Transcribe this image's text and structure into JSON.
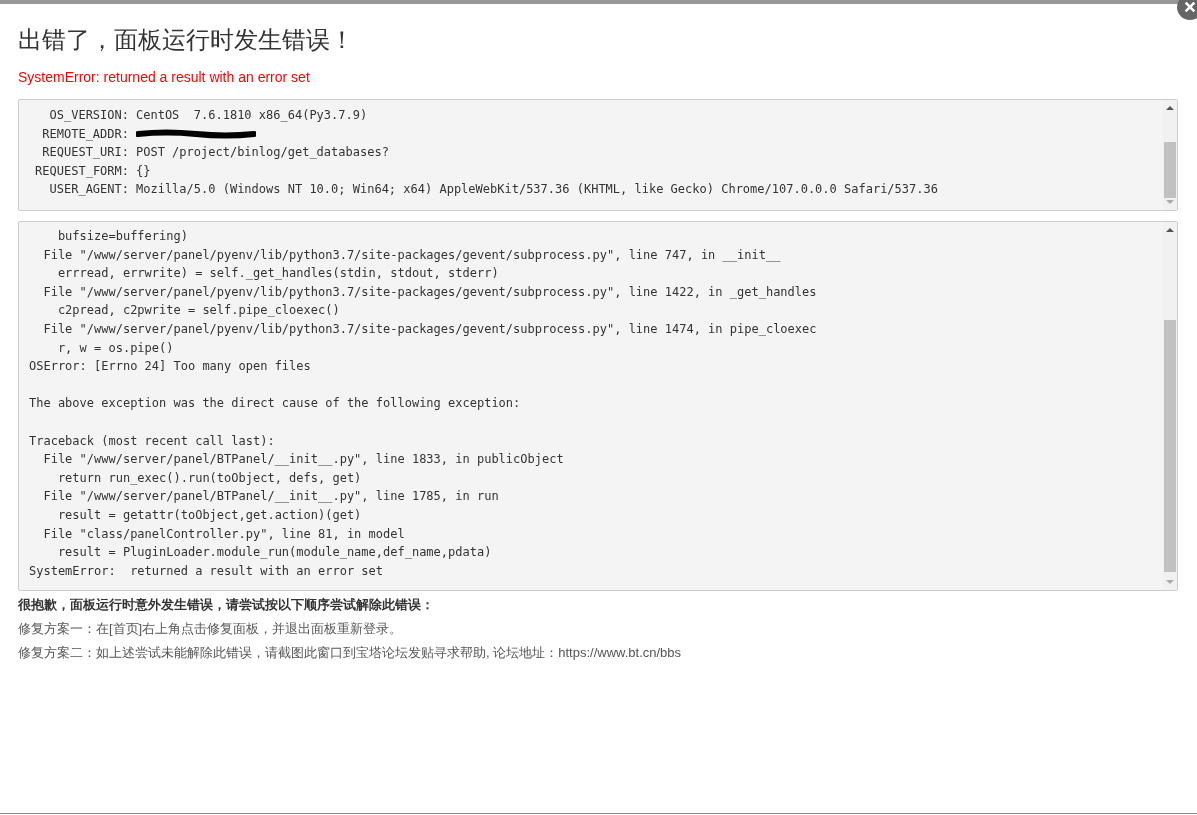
{
  "title": "出错了，面板运行时发生错误！",
  "error_message": "SystemError: returned a result with an error set",
  "environment": [
    {
      "key": "OS_VERSION:",
      "value": "CentOS  7.6.1810 x86_64(Py3.7.9)"
    },
    {
      "key": "REMOTE_ADDR:",
      "redacted": true
    },
    {
      "key": "REQUEST_URI:",
      "value": "POST /project/binlog/get_databases?"
    },
    {
      "key": "REQUEST_FORM:",
      "value": "{}"
    },
    {
      "key": "USER_AGENT:",
      "value": "Mozilla/5.0 (Windows NT 10.0; Win64; x64) AppleWebKit/537.36 (KHTML, like Gecko) Chrome/107.0.0.0 Safari/537.36"
    }
  ],
  "traceback_blocks": [
    [
      "    bufsize=buffering)",
      "  File \"/www/server/panel/pyenv/lib/python3.7/site-packages/gevent/subprocess.py\", line 747, in __init__",
      "    errread, errwrite) = self._get_handles(stdin, stdout, stderr)",
      "  File \"/www/server/panel/pyenv/lib/python3.7/site-packages/gevent/subprocess.py\", line 1422, in _get_handles",
      "    c2pread, c2pwrite = self.pipe_cloexec()",
      "  File \"/www/server/panel/pyenv/lib/python3.7/site-packages/gevent/subprocess.py\", line 1474, in pipe_cloexec",
      "    r, w = os.pipe()",
      "OSError: [Errno 24] Too many open files"
    ],
    [
      "The above exception was the direct cause of the following exception:"
    ],
    [
      "Traceback (most recent call last):",
      "  File \"/www/server/panel/BTPanel/__init__.py\", line 1833, in publicObject",
      "    return run_exec().run(toObject, defs, get)",
      "  File \"/www/server/panel/BTPanel/__init__.py\", line 1785, in run",
      "    result = getattr(toObject,get.action)(get)",
      "  File \"class/panelController.py\", line 81, in model",
      "    result = PluginLoader.module_run(module_name,def_name,pdata)",
      "SystemError:  returned a result with an error set"
    ]
  ],
  "help": {
    "heading": "很抱歉，面板运行时意外发生错误，请尝试按以下顺序尝试解除此错误：",
    "steps": [
      "修复方案一：在[首页]右上角点击修复面板，并退出面板重新登录。",
      "修复方案二：如上述尝试未能解除此错误，请截图此窗口到宝塔论坛发贴寻求帮助, 论坛地址：https://www.bt.cn/bbs"
    ]
  }
}
